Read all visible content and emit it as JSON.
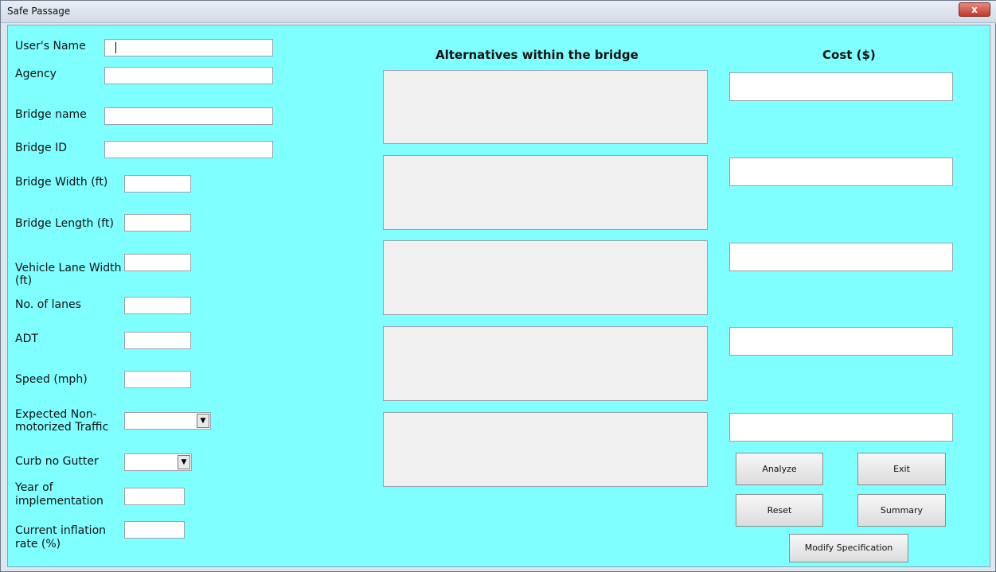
{
  "window": {
    "title": "Safe Passage",
    "close_label": "x"
  },
  "form": {
    "users_name_label": "User's Name",
    "users_name_value": "",
    "agency_label": "Agency",
    "agency_value": "",
    "bridge_name_label": "Bridge name",
    "bridge_name_value": "",
    "bridge_id_label": "Bridge ID",
    "bridge_id_value": "",
    "bridge_width_label": "Bridge Width (ft)",
    "bridge_width_value": "",
    "bridge_length_label": "Bridge Length (ft)",
    "bridge_length_value": "",
    "vehicle_lane_width_label_line1": "Vehicle Lane Width",
    "vehicle_lane_width_label_line2": "(ft)",
    "vehicle_lane_width_value": "",
    "no_of_lanes_label": "No. of lanes",
    "no_of_lanes_value": "",
    "adt_label": "ADT",
    "adt_value": "",
    "speed_label": "Speed (mph)",
    "speed_value": "",
    "expected_traffic_label_line1": "Expected Non-",
    "expected_traffic_label_line2": "motorized Traffic",
    "expected_traffic_selected": "",
    "curb_label": "Curb no Gutter",
    "curb_selected": "",
    "year_label_line1": "Year of",
    "year_label_line2": "implementation",
    "year_value": "",
    "inflation_label_line1": "Current inflation",
    "inflation_label_line2": "rate (%)",
    "inflation_value": ""
  },
  "alternatives": {
    "heading": "Alternatives within the bridge"
  },
  "cost": {
    "heading": "Cost ($)"
  },
  "buttons": {
    "analyze": "Analyze",
    "exit": "Exit",
    "reset": "Reset",
    "summary": "Summary",
    "modify": "Modify Specification"
  },
  "icons": {
    "dropdown_arrow": "dropdown-arrow-icon",
    "close": "close-icon"
  }
}
